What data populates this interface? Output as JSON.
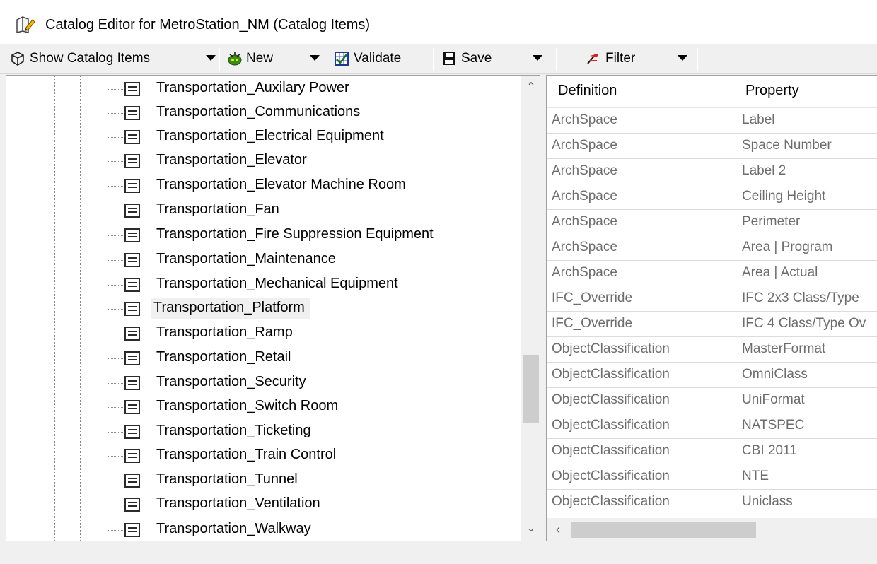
{
  "window": {
    "title": "Catalog Editor for MetroStation_NM (Catalog Items)",
    "icon": "catalog-editor-icon"
  },
  "toolbar": {
    "show_label": "Show Catalog Items",
    "new_label": "New",
    "validate_label": "Validate",
    "save_label": "Save",
    "filter_label": "Filter"
  },
  "tree": {
    "items": [
      "Transportation_Auxilary Power",
      "Transportation_Communications",
      "Transportation_Electrical Equipment",
      "Transportation_Elevator",
      "Transportation_Elevator Machine Room",
      "Transportation_Fan",
      "Transportation_Fire Suppression Equipment",
      "Transportation_Maintenance",
      "Transportation_Mechanical Equipment",
      "Transportation_Platform",
      "Transportation_Ramp",
      "Transportation_Retail",
      "Transportation_Security",
      "Transportation_Switch Room",
      "Transportation_Ticketing",
      "Transportation_Train Control",
      "Transportation_Tunnel",
      "Transportation_Ventilation",
      "Transportation_Walkway"
    ],
    "selected": "Transportation_Platform"
  },
  "grid": {
    "columns": [
      "Definition",
      "Property"
    ],
    "rows": [
      {
        "definition": "ArchSpace",
        "property": "Label"
      },
      {
        "definition": "ArchSpace",
        "property": "Space Number"
      },
      {
        "definition": "ArchSpace",
        "property": "Label 2"
      },
      {
        "definition": "ArchSpace",
        "property": "Ceiling Height"
      },
      {
        "definition": "ArchSpace",
        "property": "Perimeter"
      },
      {
        "definition": "ArchSpace",
        "property": "Area | Program"
      },
      {
        "definition": "ArchSpace",
        "property": "Area | Actual"
      },
      {
        "definition": "IFC_Override",
        "property": "IFC 2x3 Class/Type"
      },
      {
        "definition": "IFC_Override",
        "property": "IFC 4 Class/Type Ov"
      },
      {
        "definition": "ObjectClassification",
        "property": "MasterFormat"
      },
      {
        "definition": "ObjectClassification",
        "property": "OmniClass"
      },
      {
        "definition": "ObjectClassification",
        "property": "UniFormat"
      },
      {
        "definition": "ObjectClassification",
        "property": "NATSPEC"
      },
      {
        "definition": "ObjectClassification",
        "property": "CBI 2011"
      },
      {
        "definition": "ObjectClassification",
        "property": "NTE"
      },
      {
        "definition": "ObjectClassification",
        "property": "Uniclass"
      }
    ]
  },
  "colors": {
    "grid_text": "#6d6d6d",
    "selection_bg": "#f0f0f0",
    "chrome_bg": "#f0f0f0"
  }
}
